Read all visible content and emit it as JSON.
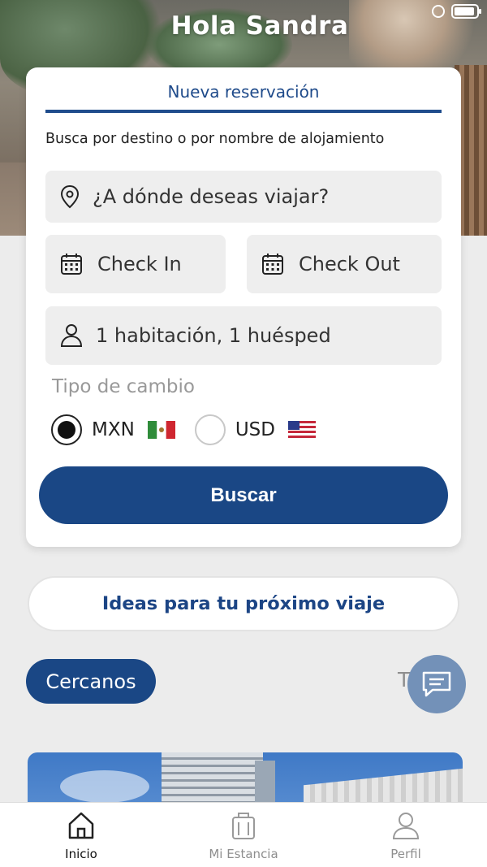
{
  "header": {
    "greeting": "Hola Sandra"
  },
  "status_bar": {
    "icons": [
      "alarm-icon",
      "battery-icon"
    ]
  },
  "booking_card": {
    "tab_label": "Nueva reservación",
    "subtitle": "Busca por destino o por nombre de alojamiento",
    "destination": {
      "placeholder": "¿A dónde deseas viajar?",
      "icon": "location-pin-icon"
    },
    "check_in": {
      "label": "Check In",
      "icon": "calendar-icon"
    },
    "check_out": {
      "label": "Check Out",
      "icon": "calendar-icon"
    },
    "guests": {
      "label": "1 habitación, 1 huésped",
      "icon": "person-icon"
    },
    "currency": {
      "label": "Tipo de cambio",
      "options": [
        {
          "code": "MXN",
          "selected": true,
          "flag": "mexico-flag-icon"
        },
        {
          "code": "USD",
          "selected": false,
          "flag": "usa-flag-icon"
        }
      ]
    },
    "search_button": "Buscar"
  },
  "ideas_button": "Ideas para tu próximo viaje",
  "filters": {
    "nearby": "Cercanos",
    "all": "Todos"
  },
  "chat_icon": "chat-icon",
  "bottom_nav": {
    "items": [
      {
        "label": "Inicio",
        "icon": "home-icon",
        "active": true
      },
      {
        "label": "Mi Estancia",
        "icon": "luggage-icon",
        "active": false
      },
      {
        "label": "Perfil",
        "icon": "profile-icon",
        "active": false
      }
    ]
  },
  "colors": {
    "primary": "#1a4785",
    "accent_text": "#1c4585",
    "chat_fab": "#7391b8",
    "field_bg": "#eeeeee"
  }
}
